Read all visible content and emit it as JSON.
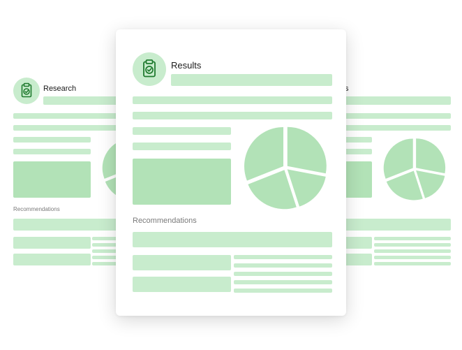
{
  "front_card": {
    "title": "Results",
    "section_label": "Recommendations",
    "icon": "clipboard-check-icon",
    "pie_slices": [
      28,
      17,
      24,
      31
    ]
  },
  "left_card": {
    "title": "Research",
    "section_label": "Recommendations",
    "icon": "clipboard-check-icon"
  },
  "right_card": {
    "title_fragment": "s",
    "pie_slices": [
      28,
      17,
      24,
      31
    ]
  },
  "colors": {
    "light_green": "#c8eccd",
    "mid_green": "#b2e2b7",
    "icon_green": "#1f7a2e"
  }
}
